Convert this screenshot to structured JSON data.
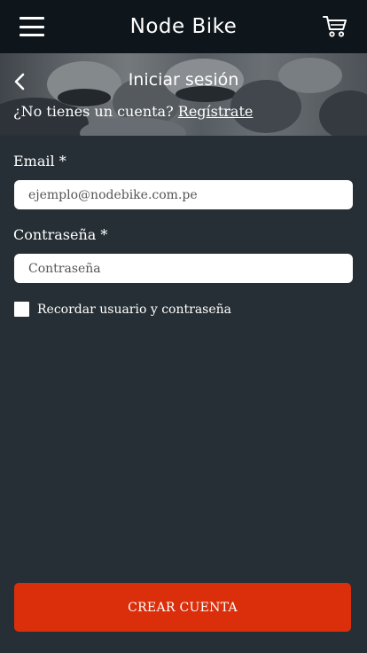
{
  "header": {
    "app_title": "Node Bike",
    "menu_icon": "hamburger-menu-icon",
    "cart_icon": "shopping-cart-icon"
  },
  "banner": {
    "title": "Iniciar sesión",
    "back_icon": "chevron-left-icon",
    "signup_prompt": "¿No tienes un cuenta?",
    "signup_link": "Regístrate"
  },
  "form": {
    "email_label": "Email *",
    "email_placeholder": "ejemplo@nodebike.com.pe",
    "password_label": "Contraseña *",
    "password_placeholder": "Contraseña",
    "remember_label": "Recordar usuario y contraseña",
    "remember_checked": false
  },
  "footer": {
    "create_button_label": "CREAR CUENTA"
  },
  "colors": {
    "topbar": "#0f161b",
    "background": "#262f35",
    "primary_button": "#db2e0b"
  }
}
